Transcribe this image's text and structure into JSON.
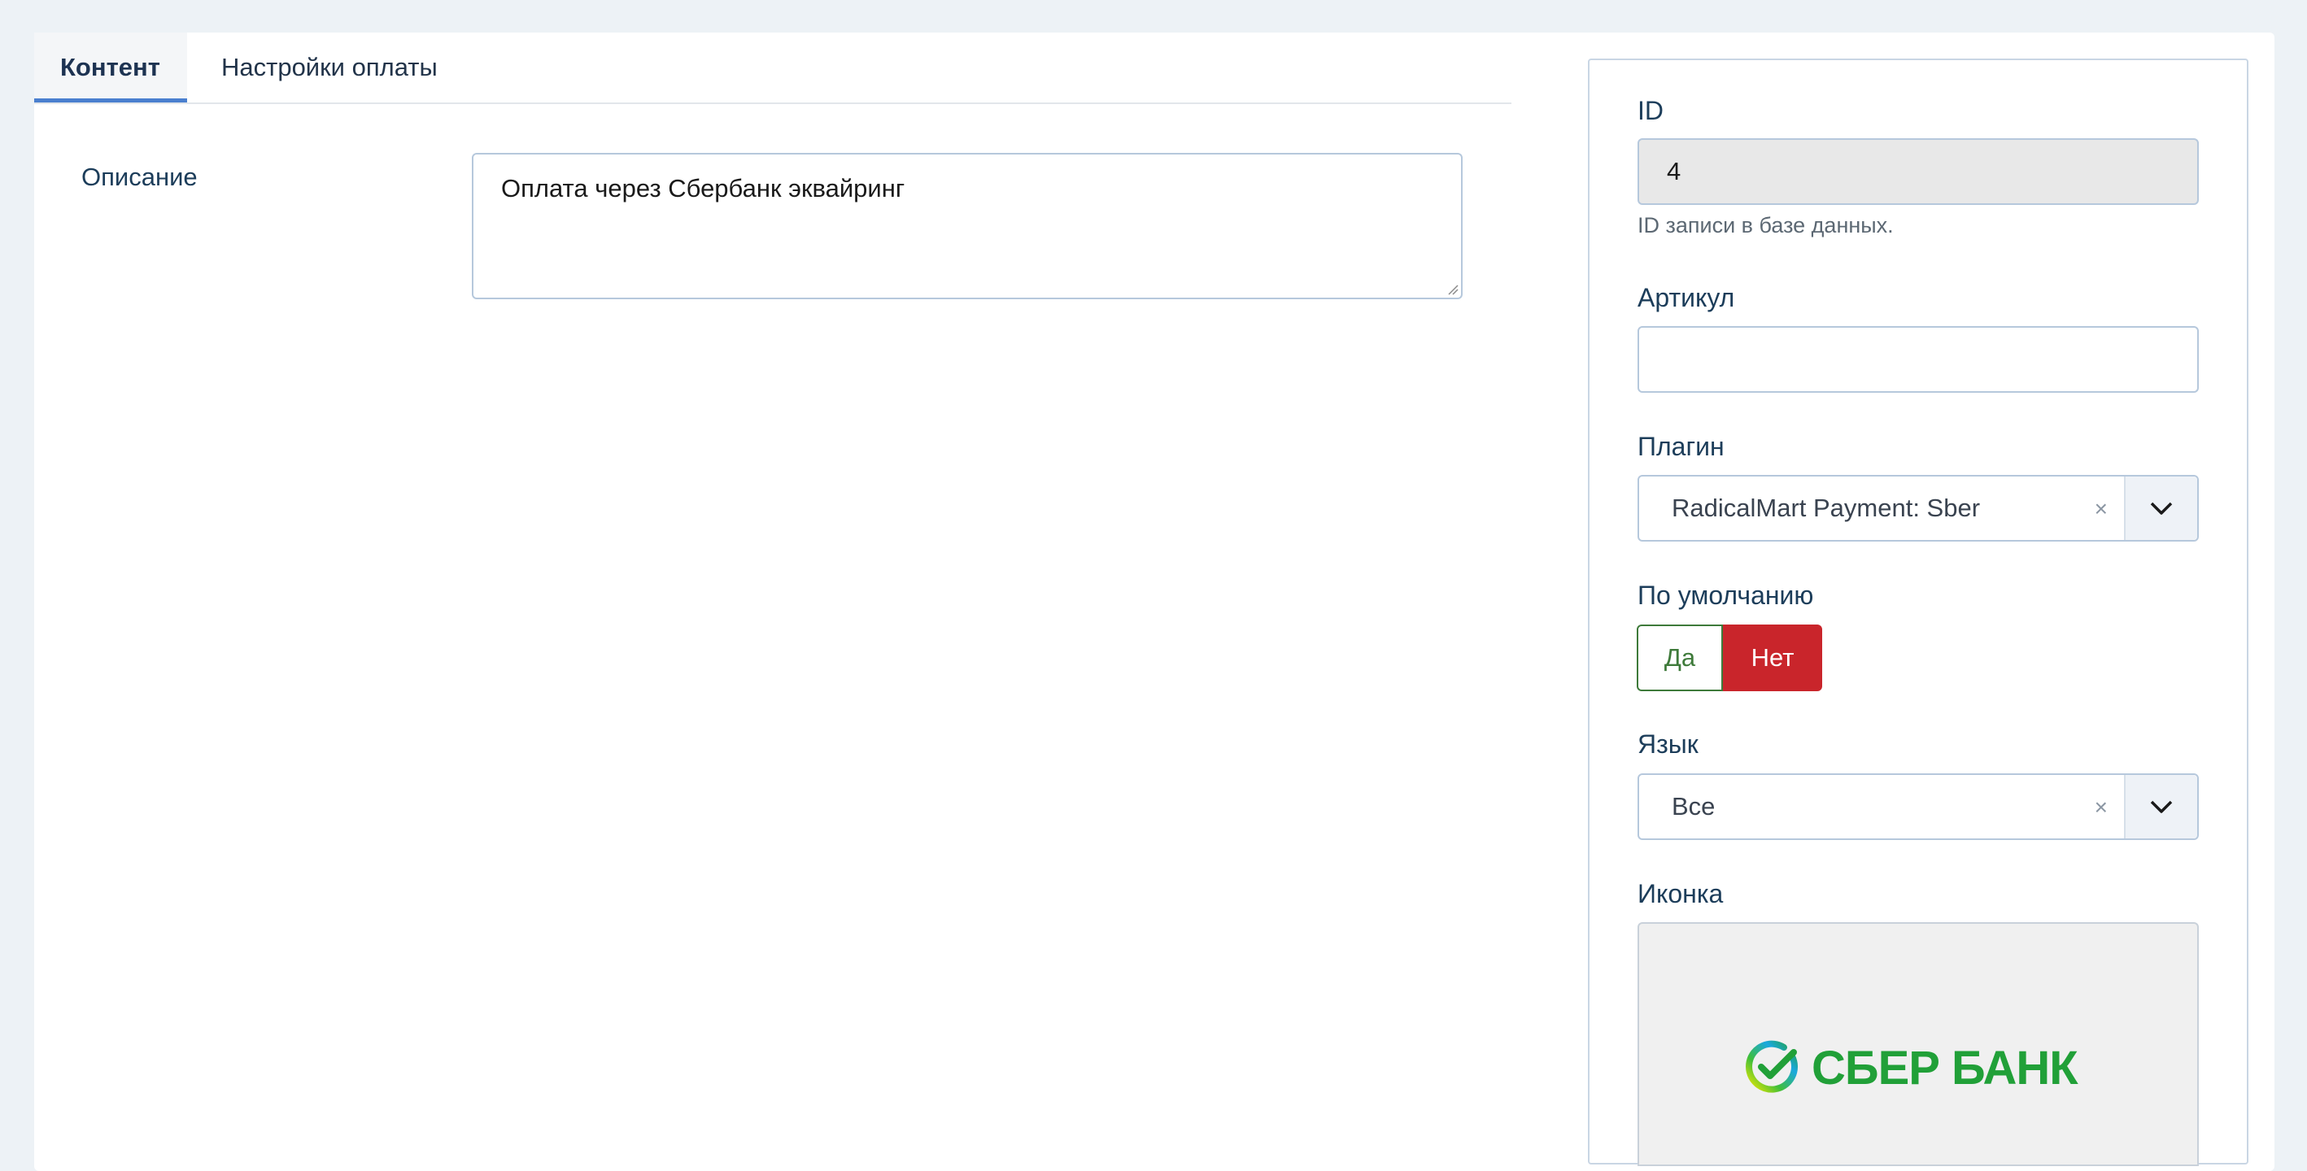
{
  "tabs": [
    {
      "label": "Контент",
      "active": true
    },
    {
      "label": "Настройки оплаты",
      "active": false
    }
  ],
  "content": {
    "description_label": "Описание",
    "description_value": "Оплата через Сбербанк эквайринг"
  },
  "sidebar": {
    "id": {
      "label": "ID",
      "value": "4",
      "hint": "ID записи в базе данных."
    },
    "sku": {
      "label": "Артикул",
      "value": ""
    },
    "plugin": {
      "label": "Плагин",
      "value": "RadicalMart Payment: Sber",
      "clear": "×"
    },
    "default": {
      "label": "По умолчанию",
      "yes": "Да",
      "no": "Нет",
      "selected": "no"
    },
    "language": {
      "label": "Язык",
      "value": "Все",
      "clear": "×"
    },
    "icon": {
      "label": "Иконка",
      "logo_text": "СБЕР БАНК",
      "logo_color": "#21a038"
    }
  },
  "colors": {
    "accent": "#4a7fcf",
    "danger": "#c9252b",
    "success": "#3e7a3a"
  }
}
